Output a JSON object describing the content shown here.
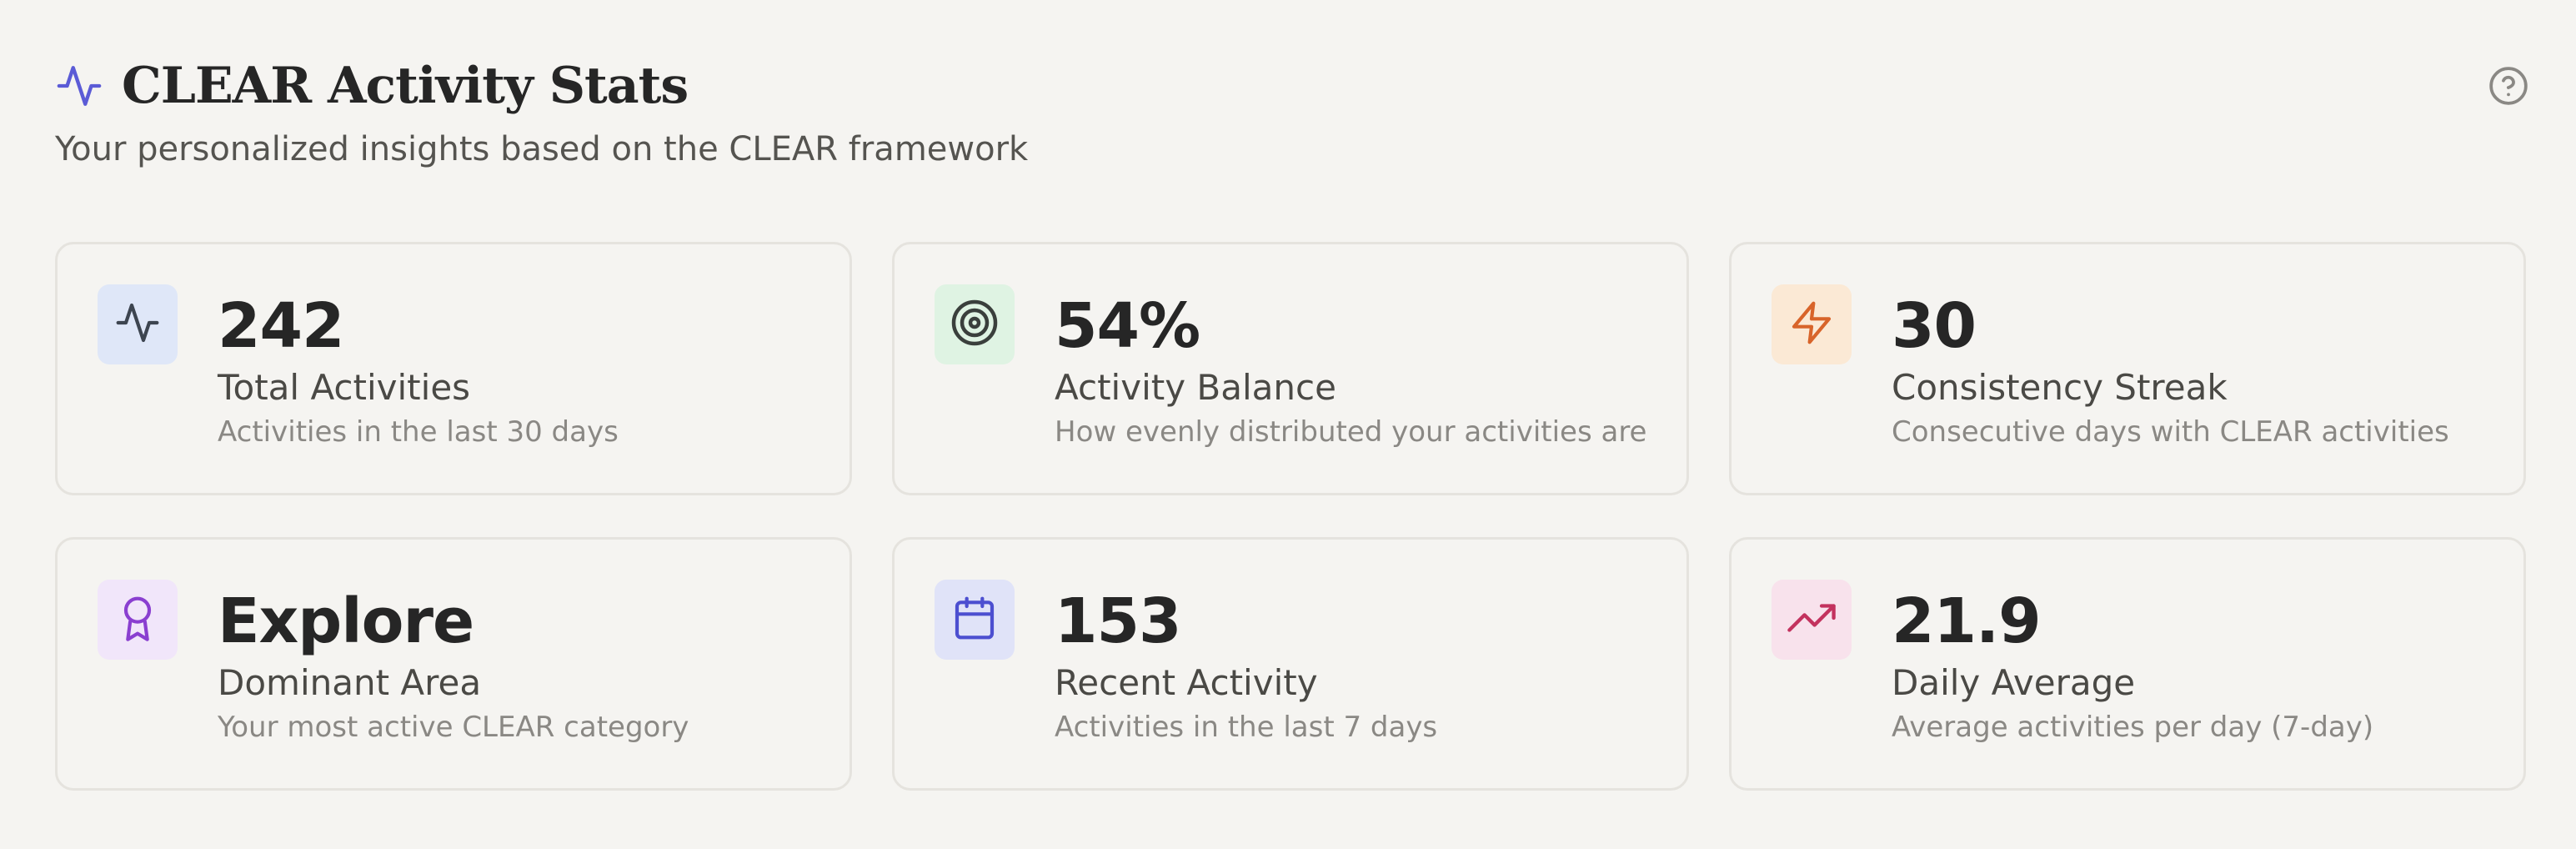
{
  "header": {
    "title": "CLEAR Activity Stats",
    "subtitle": "Your personalized insights based on the CLEAR framework",
    "title_icon": "activity-pulse-icon",
    "help_icon": "help-circle-icon"
  },
  "cards": [
    {
      "value": "242",
      "label": "Total Activities",
      "description": "Activities in the last 30 days",
      "icon": "activity-pulse-icon",
      "icon_bg": "#dfe7f8",
      "icon_color": "#3d4550"
    },
    {
      "value": "54%",
      "label": "Activity Balance",
      "description": "How evenly distributed your activities are",
      "icon": "target-icon",
      "icon_bg": "#dff3e3",
      "icon_color": "#3a3f3c"
    },
    {
      "value": "30",
      "label": "Consistency Streak",
      "description": "Consecutive days with CLEAR activities",
      "icon": "zap-icon",
      "icon_bg": "#fbe9d5",
      "icon_color": "#d8642a"
    },
    {
      "value": "Explore",
      "label": "Dominant Area",
      "description": "Your most active CLEAR category",
      "icon": "award-icon",
      "icon_bg": "#f1e6fa",
      "icon_color": "#8a3fd0"
    },
    {
      "value": "153",
      "label": "Recent Activity",
      "description": "Activities in the last 7 days",
      "icon": "calendar-icon",
      "icon_bg": "#e0e3f8",
      "icon_color": "#4c4fd0"
    },
    {
      "value": "21.9",
      "label": "Daily Average",
      "description": "Average activities per day (7-day)",
      "icon": "trending-up-icon",
      "icon_bg": "#f8e2ec",
      "icon_color": "#c3325e"
    }
  ],
  "colors": {
    "background": "#f5f4f1",
    "card_border": "#e5e3de",
    "accent": "#5b5bd6"
  }
}
